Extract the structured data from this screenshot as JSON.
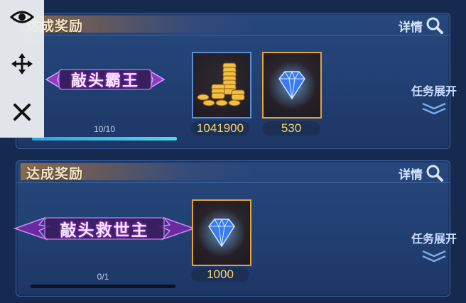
{
  "missions": [
    {
      "header_label": "达成奖励",
      "details_label": "详情",
      "badge_title": "敲头霸王",
      "rewards": [
        {
          "item": "gold-coins",
          "quantity": "1041900",
          "frame": "blue"
        },
        {
          "item": "diamond",
          "quantity": "530",
          "frame": "gold"
        }
      ],
      "expand_label": "任务展开",
      "progress_text": "10/10",
      "progress_fraction": 1.0
    },
    {
      "header_label": "达成奖励",
      "details_label": "详情",
      "badge_title": "敲头救世主",
      "rewards": [
        {
          "item": "diamond",
          "quantity": "1000",
          "frame": "gold"
        }
      ],
      "expand_label": "任务展开",
      "progress_text": "0/1",
      "progress_fraction": 0.0
    }
  ],
  "overlay_toolbar": [
    "eye-icon",
    "move-icon",
    "close-icon"
  ]
}
